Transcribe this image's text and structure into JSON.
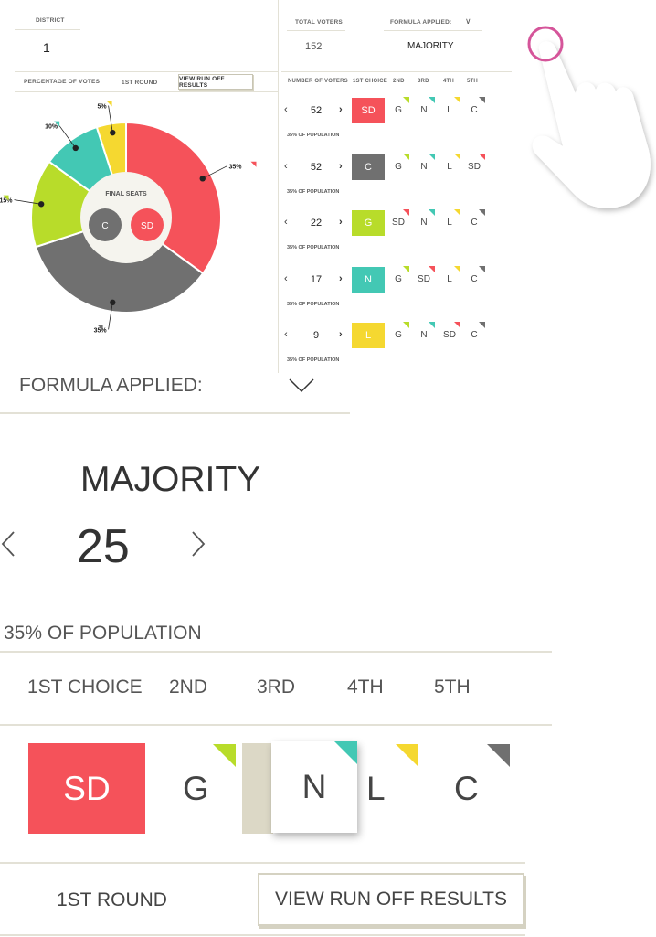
{
  "colors": {
    "sd": "#f5525a",
    "c": "#707070",
    "g": "#b8dc2a",
    "n": "#43c8b4",
    "l": "#f5d830",
    "line": "#e3e1d6",
    "touch": "#d5559a"
  },
  "top_left": {
    "district_label": "DISTRICT",
    "district_value": "1",
    "pct_votes_label": "PERCENTAGE OF VOTES",
    "round_label": "1ST ROUND",
    "runoff_button": "VIEW RUN OFF RESULTS"
  },
  "donut": {
    "center_label": "FINAL SEATS",
    "seats": [
      "C",
      "SD"
    ],
    "slices": [
      {
        "party": "SD",
        "label": "35%",
        "value": 35
      },
      {
        "party": "C",
        "label": "35%",
        "value": 35
      },
      {
        "party": "G",
        "label": "15%",
        "value": 15
      },
      {
        "party": "N",
        "label": "10%",
        "value": 10
      },
      {
        "party": "L",
        "label": "5%",
        "value": 5
      }
    ]
  },
  "top_right": {
    "total_voters_label": "TOTAL VOTERS",
    "total_voters_value": "152",
    "formula_label": "FORMULA APPLIED:",
    "formula_value": "MAJORITY",
    "headers": [
      "NUMBER OF VOTERS",
      "1ST CHOICE",
      "2ND",
      "3RD",
      "4TH",
      "5TH"
    ],
    "rows": [
      {
        "voters": "52",
        "pop": "35% OF POPULATION",
        "first": "SD",
        "rest": [
          "G",
          "N",
          "L",
          "C"
        ]
      },
      {
        "voters": "52",
        "pop": "35% OF POPULATION",
        "first": "C",
        "rest": [
          "G",
          "N",
          "L",
          "SD"
        ]
      },
      {
        "voters": "22",
        "pop": "35% OF POPULATION",
        "first": "G",
        "rest": [
          "SD",
          "N",
          "L",
          "C"
        ]
      },
      {
        "voters": "17",
        "pop": "35% OF POPULATION",
        "first": "N",
        "rest": [
          "G",
          "SD",
          "L",
          "C"
        ]
      },
      {
        "voters": "9",
        "pop": "35% OF POPULATION",
        "first": "L",
        "rest": [
          "G",
          "N",
          "SD",
          "C"
        ]
      }
    ]
  },
  "zoom": {
    "formula_label": "FORMULA APPLIED:",
    "formula_value": "MAJORITY",
    "count": "25",
    "population": "35% OF POPULATION",
    "headers": [
      "1ST CHOICE",
      "2ND",
      "3RD",
      "4TH",
      "5TH"
    ],
    "first_choice": "SD",
    "rest": [
      "G",
      "N",
      "L",
      "C"
    ],
    "round_label": "1ST ROUND",
    "runoff_button": "VIEW RUN OFF RESULTS"
  }
}
